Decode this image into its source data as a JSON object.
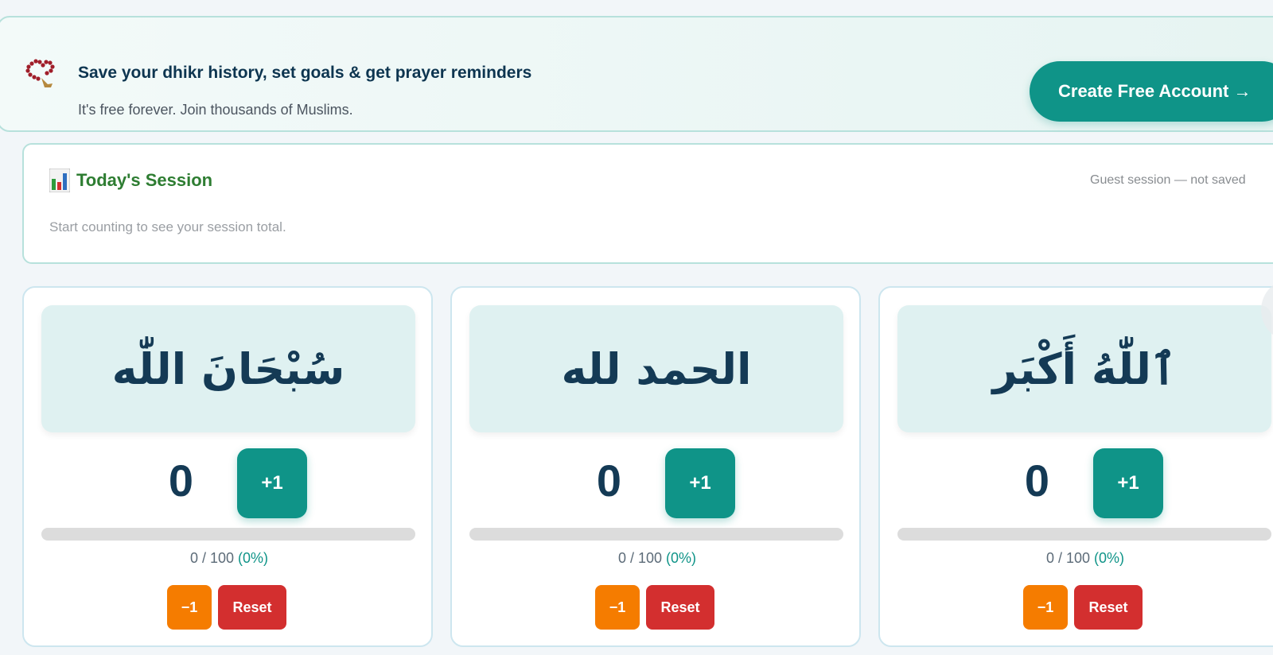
{
  "banner": {
    "icon": "prayer-beads-icon",
    "title": "Save your dhikr history, set goals & get prayer reminders",
    "subtitle": "It's free forever. Join thousands of Muslims.",
    "cta_label": "Create Free Account →"
  },
  "session": {
    "icon": "bar-chart-icon",
    "title": "Today's Session",
    "guest_note": "Guest session — not saved",
    "hint": "Start counting to see your session total."
  },
  "counters": [
    {
      "arabic": "سُبْحَانَ اللّٰه",
      "count": "0",
      "increment_label": "+1",
      "progress_text": "0 / 100",
      "progress_pct": "(0%)",
      "progress_value": 0,
      "decrement_label": "−1",
      "reset_label": "Reset"
    },
    {
      "arabic": "الحمد لله",
      "count": "0",
      "increment_label": "+1",
      "progress_text": "0 / 100",
      "progress_pct": "(0%)",
      "progress_value": 0,
      "decrement_label": "−1",
      "reset_label": "Reset"
    },
    {
      "arabic": "ٱللّٰهُ أَكْبَر",
      "count": "0",
      "increment_label": "+1",
      "progress_text": "0 / 100",
      "progress_pct": "(0%)",
      "progress_value": 0,
      "decrement_label": "−1",
      "reset_label": "Reset"
    }
  ],
  "colors": {
    "accent": "#0f9488",
    "decrement": "#f57c00",
    "reset": "#d32f2f",
    "heading_green": "#2e7d32",
    "text_dark": "#143a55"
  }
}
